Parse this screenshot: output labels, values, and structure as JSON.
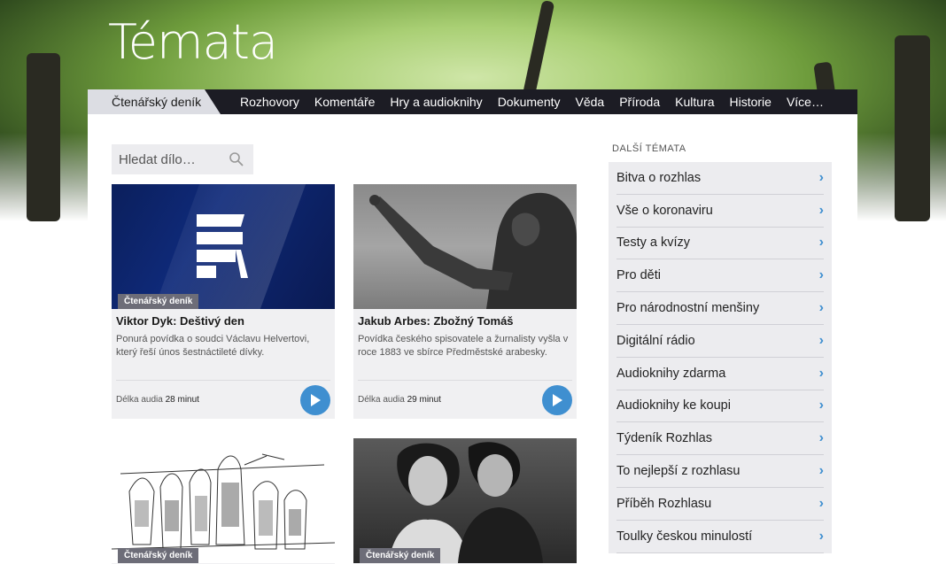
{
  "page": {
    "title": "Témata"
  },
  "nav": {
    "active": "Čtenářský deník",
    "items": [
      "Rozhovory",
      "Komentáře",
      "Hry a audioknihy",
      "Dokumenty",
      "Věda",
      "Příroda",
      "Kultura",
      "Historie",
      "Více…"
    ]
  },
  "search": {
    "placeholder": "Hledat dílo…",
    "icon": "search-icon"
  },
  "cards": [
    {
      "badge": "Čtenářský deník",
      "title": "Viktor Dyk: Deštivý den",
      "desc": "Ponurá povídka o soudci Václavu Helvertovi, který řeší únos šestnáctileté dívky.",
      "length_label": "Délka audia",
      "length_value": "28 minut",
      "image": "rozhlas-logo"
    },
    {
      "badge": "",
      "title": "Jakub Arbes: Zbožný Tomáš",
      "desc": "Povídka českého spisovatele a žurnalisty vyšla v roce 1883 ve sbírce Předměstské arabesky.",
      "length_label": "Délka audia",
      "length_value": "29 minut",
      "image": "statue-photo"
    },
    {
      "badge": "Čtenářský deník",
      "image": "engraving-crowd"
    },
    {
      "badge": "Čtenářský deník",
      "image": "film-still-couple"
    }
  ],
  "sidebar": {
    "title": "DALŠÍ TÉMATA",
    "items": [
      "Bitva o rozhlas",
      "Vše o koronaviru",
      "Testy a kvízy",
      "Pro děti",
      "Pro národnostní menšiny",
      "Digitální rádio",
      "Audioknihy zdarma",
      "Audioknihy ke koupi",
      "Týdeník Rozhlas",
      "To nejlepší z rozhlasu",
      "Příběh Rozhlasu",
      "Toulky českou minulostí"
    ]
  },
  "colors": {
    "accent": "#3f8fd0",
    "nav_bg": "#1c1c24",
    "badge_bg": "#6d6d78"
  }
}
